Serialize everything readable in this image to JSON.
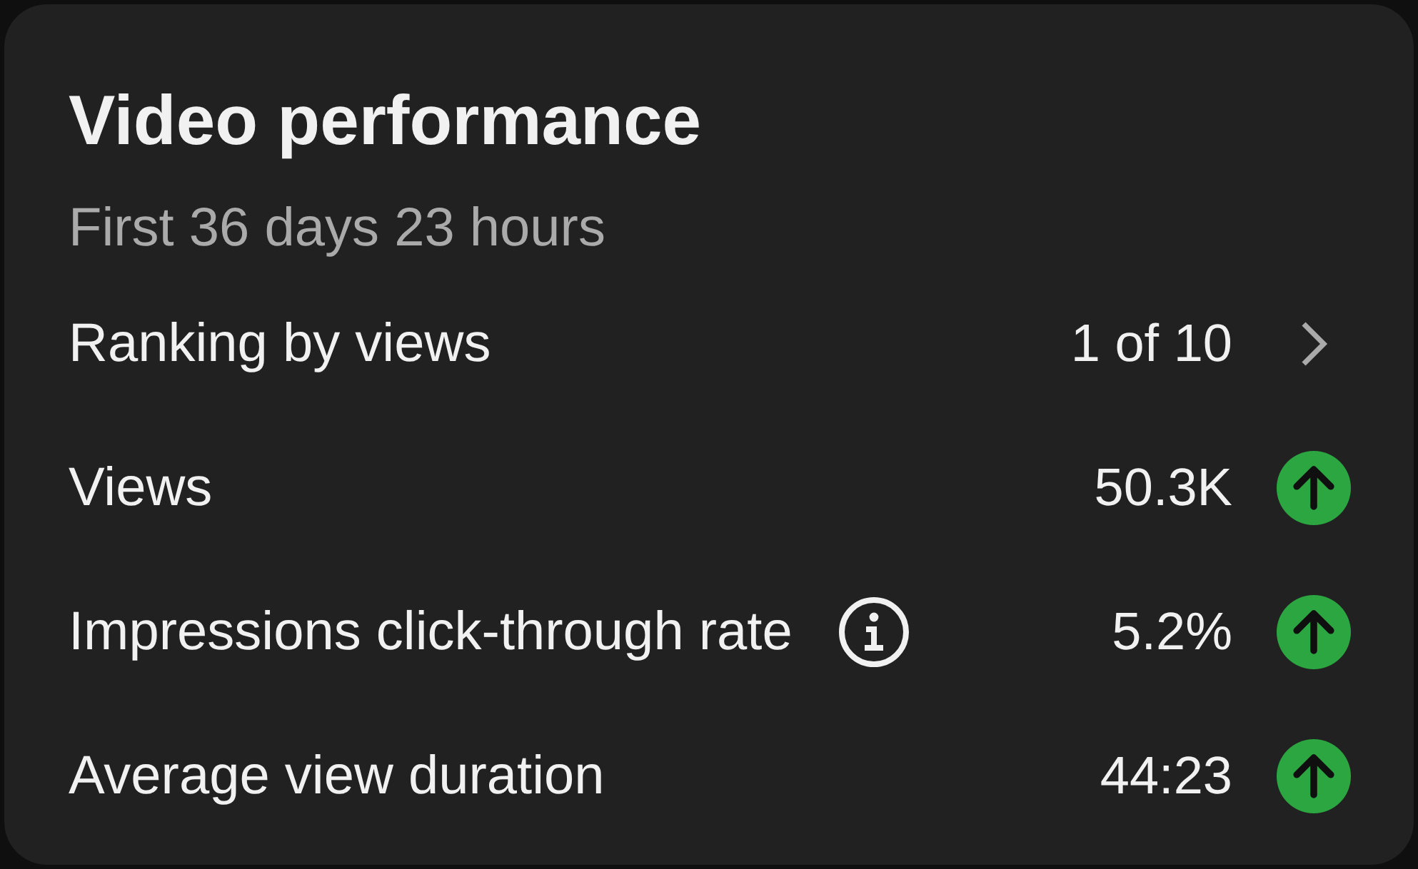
{
  "card": {
    "title": "Video performance",
    "subtitle": "First 36 days 23 hours",
    "rows": [
      {
        "kind": "ranking",
        "label": "Ranking by views",
        "value": "1 of 10",
        "info": false
      },
      {
        "kind": "metric",
        "label": "Views",
        "value": "50.3K",
        "info": false,
        "rising": true
      },
      {
        "kind": "metric",
        "label": "Impressions click-through rate",
        "value": "5.2%",
        "info": true,
        "rising": true
      },
      {
        "kind": "metric",
        "label": "Average view duration",
        "value": "44:23",
        "info": false,
        "rising": true
      }
    ]
  }
}
